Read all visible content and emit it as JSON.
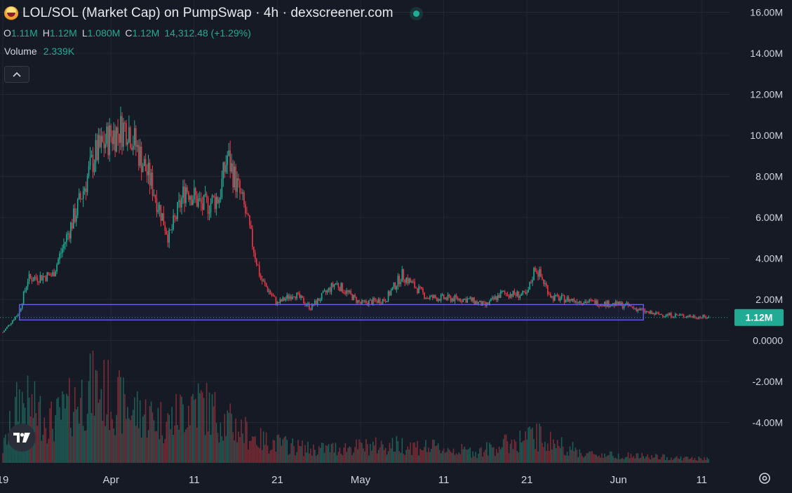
{
  "header": {
    "title": "LOL/SOL (Market Cap) on PumpSwap · 4h · dexscreener.com",
    "ohlc": [
      {
        "key": "O",
        "value": "1.11M"
      },
      {
        "key": "H",
        "value": "1.12M"
      },
      {
        "key": "L",
        "value": "1.080M"
      },
      {
        "key": "C",
        "value": "1.12M"
      }
    ],
    "change": "14,312.48 (+1.29%)",
    "volume_label": "Volume",
    "volume_value": "2.339K",
    "collapse_icon": "chevron-up-icon"
  },
  "colors": {
    "background": "#161a25",
    "grid": "#232734",
    "up": "#22ab94",
    "down": "#f23645",
    "up_volume": "#1e5c55",
    "down_volume": "#7a2b35",
    "highlight_box": "#6b5cf0",
    "price_badge": "#22ab94",
    "axis_text": "#d1d4dc"
  },
  "chart_data": {
    "type": "candlestick",
    "interval": "4h",
    "y_unit": "market cap",
    "ylim": [
      -6000000,
      16500000
    ],
    "y_ticks": [
      "16.00M",
      "14.00M",
      "12.00M",
      "10.00M",
      "8.00M",
      "6.00M",
      "4.00M",
      "2.00M",
      "0.0000",
      "-2.00M",
      "-4.00M"
    ],
    "y_tick_values": [
      16000000,
      14000000,
      12000000,
      10000000,
      8000000,
      6000000,
      4000000,
      2000000,
      0,
      -2000000,
      -4000000
    ],
    "x_ticks": [
      "19",
      "Apr",
      "11",
      "21",
      "May",
      "11",
      "21",
      "Jun",
      "11"
    ],
    "current_price_label": "1.12M",
    "current_price": 1120000,
    "highlight_range": {
      "low": 1000000,
      "high": 1750000,
      "from": "Mar 21",
      "to": "Jun 4"
    },
    "price_path": [
      {
        "date": "Mar 19",
        "value": 400000
      },
      {
        "date": "Mar 21",
        "value": 1400000
      },
      {
        "date": "Mar 22",
        "value": 3000000
      },
      {
        "date": "Mar 25",
        "value": 3200000
      },
      {
        "date": "Mar 28",
        "value": 6500000
      },
      {
        "date": "Mar 30",
        "value": 9000000
      },
      {
        "date": "Apr 1",
        "value": 10000000
      },
      {
        "date": "Apr 3",
        "value": 10500000
      },
      {
        "date": "Apr 6",
        "value": 7500000
      },
      {
        "date": "Apr 8",
        "value": 5000000
      },
      {
        "date": "Apr 10",
        "value": 7500000
      },
      {
        "date": "Apr 12",
        "value": 6500000
      },
      {
        "date": "Apr 14",
        "value": 7000000
      },
      {
        "date": "Apr 15",
        "value": 9000000
      },
      {
        "date": "Apr 17",
        "value": 6500000
      },
      {
        "date": "Apr 19",
        "value": 3000000
      },
      {
        "date": "Apr 21",
        "value": 1800000
      },
      {
        "date": "Apr 23",
        "value": 2300000
      },
      {
        "date": "Apr 25",
        "value": 1600000
      },
      {
        "date": "Apr 28",
        "value": 2800000
      },
      {
        "date": "May 1",
        "value": 1800000
      },
      {
        "date": "May 4",
        "value": 2000000
      },
      {
        "date": "May 6",
        "value": 3200000
      },
      {
        "date": "May 9",
        "value": 2100000
      },
      {
        "date": "May 14",
        "value": 2000000
      },
      {
        "date": "May 16",
        "value": 1700000
      },
      {
        "date": "May 18",
        "value": 2300000
      },
      {
        "date": "May 21",
        "value": 2200000
      },
      {
        "date": "May 22",
        "value": 3600000
      },
      {
        "date": "May 24",
        "value": 2100000
      },
      {
        "date": "May 28",
        "value": 1900000
      },
      {
        "date": "Jun 2",
        "value": 1700000
      },
      {
        "date": "Jun 5",
        "value": 1300000
      },
      {
        "date": "Jun 9",
        "value": 1200000
      },
      {
        "date": "Jun 12",
        "value": 1120000
      }
    ],
    "volume_path": [
      {
        "date": "Mar 19",
        "value": 0.15
      },
      {
        "date": "Mar 21",
        "value": 0.7
      },
      {
        "date": "Mar 25",
        "value": 0.45
      },
      {
        "date": "Mar 30",
        "value": 0.85
      },
      {
        "date": "Apr 3",
        "value": 0.6
      },
      {
        "date": "Apr 8",
        "value": 0.45
      },
      {
        "date": "Apr 11",
        "value": 0.7
      },
      {
        "date": "Apr 15",
        "value": 0.45
      },
      {
        "date": "Apr 19",
        "value": 0.25
      },
      {
        "date": "Apr 25",
        "value": 0.15
      },
      {
        "date": "May 6",
        "value": 0.2
      },
      {
        "date": "May 15",
        "value": 0.12
      },
      {
        "date": "May 22",
        "value": 0.3
      },
      {
        "date": "May 28",
        "value": 0.1
      },
      {
        "date": "Jun 12",
        "value": 0.04
      }
    ]
  },
  "controls": {
    "tv_logo_icon": "tradingview-logo-icon",
    "settings_icon": "gear-icon"
  }
}
